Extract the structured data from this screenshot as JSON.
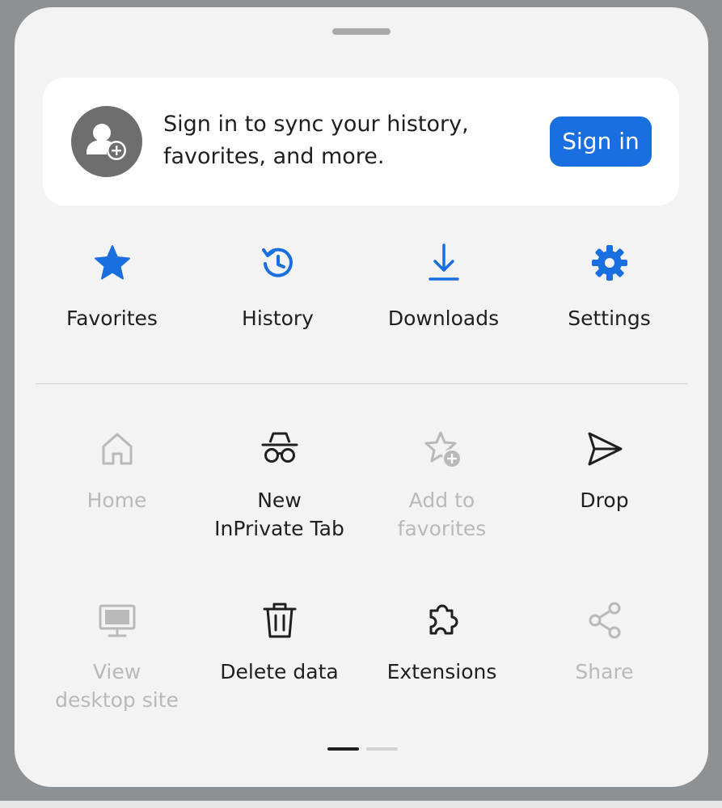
{
  "signin": {
    "message": "Sign in to sync your history, favorites, and more.",
    "button_label": "Sign in",
    "avatar_icon": "person-add-icon"
  },
  "quick_actions": [
    {
      "label": "Favorites",
      "icon": "star-icon"
    },
    {
      "label": "History",
      "icon": "history-icon"
    },
    {
      "label": "Downloads",
      "icon": "download-icon"
    },
    {
      "label": "Settings",
      "icon": "gear-icon"
    }
  ],
  "menu_items": [
    {
      "label": "Home",
      "icon": "home-icon",
      "enabled": false
    },
    {
      "label": "New\nInPrivate Tab",
      "icon": "inprivate-icon",
      "enabled": true
    },
    {
      "label": "Add to\nfavorites",
      "icon": "star-add-icon",
      "enabled": false
    },
    {
      "label": "Drop",
      "icon": "send-icon",
      "enabled": true
    },
    {
      "label": "View\ndesktop site",
      "icon": "desktop-icon",
      "enabled": false
    },
    {
      "label": "Delete data",
      "icon": "trash-icon",
      "enabled": true
    },
    {
      "label": "Extensions",
      "icon": "puzzle-icon",
      "enabled": true
    },
    {
      "label": "Share",
      "icon": "share-icon",
      "enabled": false
    }
  ],
  "pager": {
    "current_page": 1,
    "total_pages": 2
  },
  "colors": {
    "accent": "#1a6fe0",
    "text": "#1f1f1f",
    "disabled": "#b9b9b9",
    "sheet": "#f3f3f3"
  }
}
